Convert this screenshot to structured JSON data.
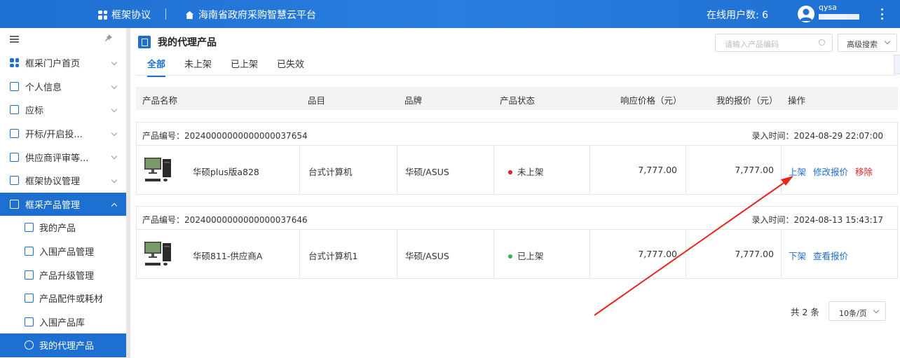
{
  "header": {
    "app_name": "框架协议",
    "platform": "海南省政府采购智慧云平台",
    "online_users": "在线用户数: 6",
    "username": "qysa"
  },
  "sidebar": {
    "items": [
      {
        "label": "框采门户首页",
        "icon": "grid-icon"
      },
      {
        "label": "个人信息",
        "icon": "id-card-icon"
      },
      {
        "label": "应标",
        "icon": "document-icon"
      },
      {
        "label": "开标/开启投...",
        "icon": "document-icon"
      },
      {
        "label": "供应商评审等...",
        "icon": "monitor-icon"
      },
      {
        "label": "框架协议管理",
        "icon": "agreement-icon"
      },
      {
        "label": "框采产品管理",
        "icon": "product-icon"
      }
    ],
    "sub_items": [
      {
        "label": "我的产品"
      },
      {
        "label": "入围产品管理"
      },
      {
        "label": "产品升级管理"
      },
      {
        "label": "产品配件或耗材"
      },
      {
        "label": "入围产品库"
      },
      {
        "label": "我的代理产品"
      }
    ]
  },
  "page": {
    "title": "我的代理产品",
    "search_placeholder": "请输入产品编码",
    "advanced_search": "高级搜索",
    "tabs": [
      "全部",
      "未上架",
      "已上架",
      "已失效"
    ]
  },
  "table": {
    "headers": [
      "产品名称",
      "品目",
      "品牌",
      "产品状态",
      "响应价格（元）",
      "我的报价（元）",
      "操作"
    ],
    "groups": [
      {
        "code": "产品编号：20240000000000000037654",
        "time": "录入时间：2024-08-29 22:07:00",
        "name": "华硕plus版a828",
        "category": "台式计算机",
        "brand": "华硕/ASUS",
        "status": "未上架",
        "status_color": "#e02020",
        "response_price": "7,777.00",
        "my_price": "7,777.00",
        "actions": [
          "上架",
          "修改报价",
          "移除"
        ]
      },
      {
        "code": "产品编号：20240000000000000037646",
        "time": "录入时间：2024-08-13 15:43:17",
        "name": "华硕811-供应商A",
        "category": "台式计算机1",
        "brand": "华硕/ASUS",
        "status": "已上架",
        "status_color": "#2db84d",
        "response_price": "7,777.00",
        "my_price": "7,777.00",
        "actions": [
          "下架",
          "查看报价"
        ]
      }
    ]
  },
  "pagination": {
    "total": "共 2 条",
    "page_size": "10条/页"
  },
  "colors": {
    "primary": "#1d6fd1",
    "danger": "#e02020",
    "success": "#2db84d",
    "annotation_arrow": "#e8261c"
  }
}
